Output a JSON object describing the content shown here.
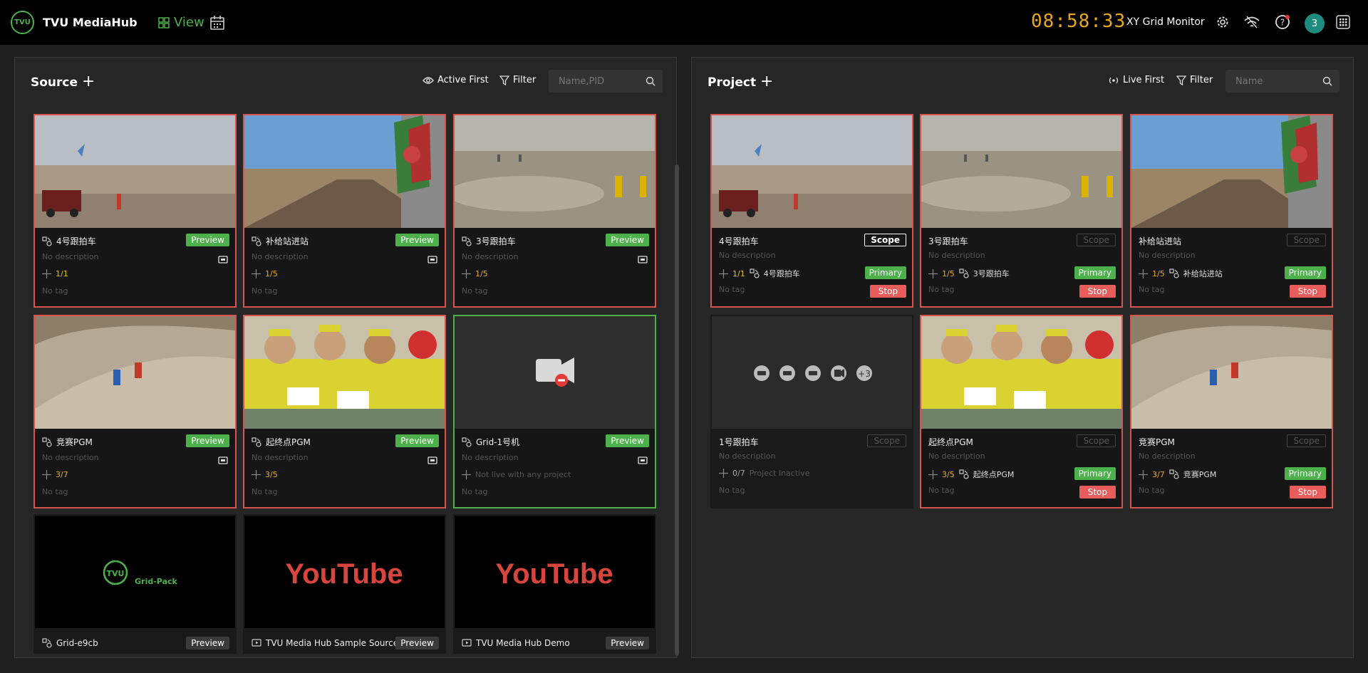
{
  "header": {
    "logo_text": "TVU",
    "brand": "TVU MediaHub",
    "view_label": "View",
    "clock": "08:58:33",
    "monitor": "XY Grid Monitor",
    "avatar": "3",
    "icons": [
      "grid-view-icon",
      "calendar-icon",
      "gear-icon",
      "signal-icon",
      "help-icon",
      "apps-grid-icon"
    ]
  },
  "source": {
    "title": "Source",
    "active_first": "Active First",
    "filter": "Filter",
    "search_placeholder": "Name,PID",
    "preview_label": "Preview",
    "cards": [
      {
        "name": "4号跟拍车",
        "desc": "No description",
        "count": "1/1",
        "tag": "No tag",
        "countColor": "#e6c300"
      },
      {
        "name": "补给站进站",
        "desc": "No description",
        "count": "1/5",
        "tag": "No tag",
        "countColor": "#e6a817"
      },
      {
        "name": "3号跟拍车",
        "desc": "No description",
        "count": "1/5",
        "tag": "No tag",
        "countColor": "#e6a817"
      },
      {
        "name": "竞赛PGM",
        "desc": "No description",
        "count": "3/7",
        "tag": "No tag",
        "countColor": "#e6a817"
      },
      {
        "name": "起终点PGM",
        "desc": "No description",
        "count": "3/5",
        "tag": "No tag",
        "countColor": "#e6a817"
      },
      {
        "name": "Grid-1号机",
        "desc": "No description",
        "count": "Not live with any project",
        "tag": "No tag",
        "countColor": "#555"
      },
      {
        "name": "Grid-e9cb",
        "thumb": "Grid-Pack"
      },
      {
        "name": "TVU Media Hub Sample Source",
        "thumb": "YouTube"
      },
      {
        "name": "TVU Media Hub Demo",
        "thumb": "YouTube"
      }
    ]
  },
  "project": {
    "title": "Project",
    "live_first": "Live First",
    "filter": "Filter",
    "search_placeholder": "Name",
    "scope_label": "Scope",
    "primary_label": "Primary",
    "stop_label": "Stop",
    "cards": [
      {
        "name": "4号跟拍车",
        "desc": "No description",
        "count": "1/1",
        "src": "4号跟拍车",
        "tag": "No tag",
        "countColor": "#e6c300"
      },
      {
        "name": "3号跟拍车",
        "desc": "No description",
        "count": "1/5",
        "src": "3号跟拍车",
        "tag": "No tag",
        "countColor": "#e6a817"
      },
      {
        "name": "补给站进站",
        "desc": "No description",
        "count": "1/5",
        "src": "补给站进站",
        "tag": "No tag",
        "countColor": "#e6a817"
      },
      {
        "name": "1号跟拍车",
        "desc": "No description",
        "count": "0/7",
        "src": "Project Inactive",
        "tag": "No tag",
        "countColor": "#aaa",
        "plus": "+3"
      },
      {
        "name": "起终点PGM",
        "desc": "No description",
        "count": "3/5",
        "src": "起终点PGM",
        "tag": "No tag",
        "countColor": "#e6a817"
      },
      {
        "name": "竞赛PGM",
        "desc": "No description",
        "count": "3/7",
        "src": "竞赛PGM",
        "tag": "No tag",
        "countColor": "#e6a817"
      }
    ]
  }
}
